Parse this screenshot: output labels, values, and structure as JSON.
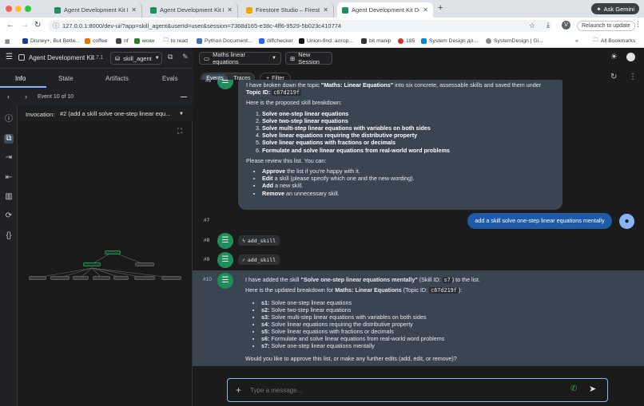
{
  "browser": {
    "tabs": [
      {
        "title": "Agent Development Kit Dev U",
        "active": false
      },
      {
        "title": "Agent Development Kit Dev U",
        "active": false
      },
      {
        "title": "Firestore Studio – Firestore -",
        "active": false
      },
      {
        "title": "Agent Development Kit Dev U",
        "active": true
      }
    ],
    "new_tab": "+",
    "ask_gemini": "Ask Gemini",
    "url": "127.0.0.1:8000/dev-ui/?app=skill_agent&userId=user&session=7368d165-e38c-4ff6-9529-5b023c410774",
    "relaunch": "Relaunch to update",
    "bookmarks": [
      "Disney+, But Bette...",
      "coffee",
      "nf",
      "моки",
      "to read",
      "Python Document...",
      "diffchecker",
      "Union-find: алгор...",
      "bit manip",
      "185",
      "System Design дл...",
      "SystemDesign | Gi..."
    ],
    "bookmarks_more": "»",
    "all_bookmarks": "All Bookmarks"
  },
  "app": {
    "title": "Agent Development Kit",
    "version": "2.7.1",
    "agent": "skill_agent",
    "session_select": "Maths linear equations",
    "new_session": "New Session"
  },
  "left": {
    "tabs": [
      "Info",
      "State",
      "Artifacts",
      "Evals"
    ],
    "event_label": "Event 10 of 10",
    "invocation_label": "Invocation:",
    "invocation_value": "#2 (add a skill solve one-step linear equ..."
  },
  "right": {
    "toggle": [
      "Events",
      "Traces"
    ],
    "filter": "Filter"
  },
  "chat": {
    "msg6": {
      "label": "#6",
      "intro_a": "I have broken down the topic ",
      "intro_topic": "\"Maths: Linear Equations\"",
      "intro_b": " into six concrete, assessable skills and saved them under ",
      "topic_id_label": "Topic ID: ",
      "topic_id": "c67d219f",
      "proposal_heading": "Here is the proposed skill breakdown:",
      "skills": [
        "Solve one-step linear equations",
        "Solve two-step linear equations",
        "Solve multi-step linear equations with variables on both sides",
        "Solve linear equations requiring the distributive property",
        "Solve linear equations with fractions or decimals",
        "Formulate and solve linear equations from real-world word problems"
      ],
      "review": "Please review this list. You can:",
      "options": [
        {
          "bold": "Approve",
          "rest": " the list if you're happy with it."
        },
        {
          "bold": "Edit",
          "rest": " a skill (please specify which one and the new wording)."
        },
        {
          "bold": "Add",
          "rest": " a new skill."
        },
        {
          "bold": "Remove",
          "rest": " an unnecessary skill."
        }
      ]
    },
    "msg7": {
      "label": "#7",
      "text": "add a skill solve one-step linear equations mentally"
    },
    "msg8": {
      "label": "#8",
      "tool": "add_skill"
    },
    "msg9": {
      "label": "#9",
      "tool": "add_skill"
    },
    "msg10": {
      "label": "#10",
      "line1_a": "I have added the skill ",
      "line1_skill": "\"Solve one-step linear equations mentally\"",
      "line1_b": " (Skill ID: ",
      "skill_id": "s7",
      "line1_c": ") to the list.",
      "line2_a": "Here is the updated breakdown for ",
      "line2_topic": "Maths: Linear Equations",
      "line2_b": " (Topic ID: ",
      "topic_id": "c67d219f",
      "line2_c": "):",
      "items": [
        {
          "id": "s1:",
          "text": " Solve one-step linear equations"
        },
        {
          "id": "s2:",
          "text": " Solve two-step linear equations"
        },
        {
          "id": "s3:",
          "text": " Solve multi-step linear equations with variables on both sides"
        },
        {
          "id": "s4:",
          "text": " Solve linear equations requiring the distributive property"
        },
        {
          "id": "s5:",
          "text": " Solve linear equations with fractions or decimals"
        },
        {
          "id": "s6:",
          "text": " Formulate and solve linear equations from real-world word problems"
        },
        {
          "id": "s7:",
          "text": " Solve one-step linear equations mentally"
        }
      ],
      "question": "Would you like to approve this list, or make any further edits (add, edit, or remove)?"
    }
  },
  "composer": {
    "placeholder": "Type a message..."
  },
  "colors": {
    "accent": "#8ab4f8",
    "user_bubble": "#1f5aa6",
    "agent_avatar": "#1e8e5a",
    "agent_bubble": "#3b4451"
  }
}
